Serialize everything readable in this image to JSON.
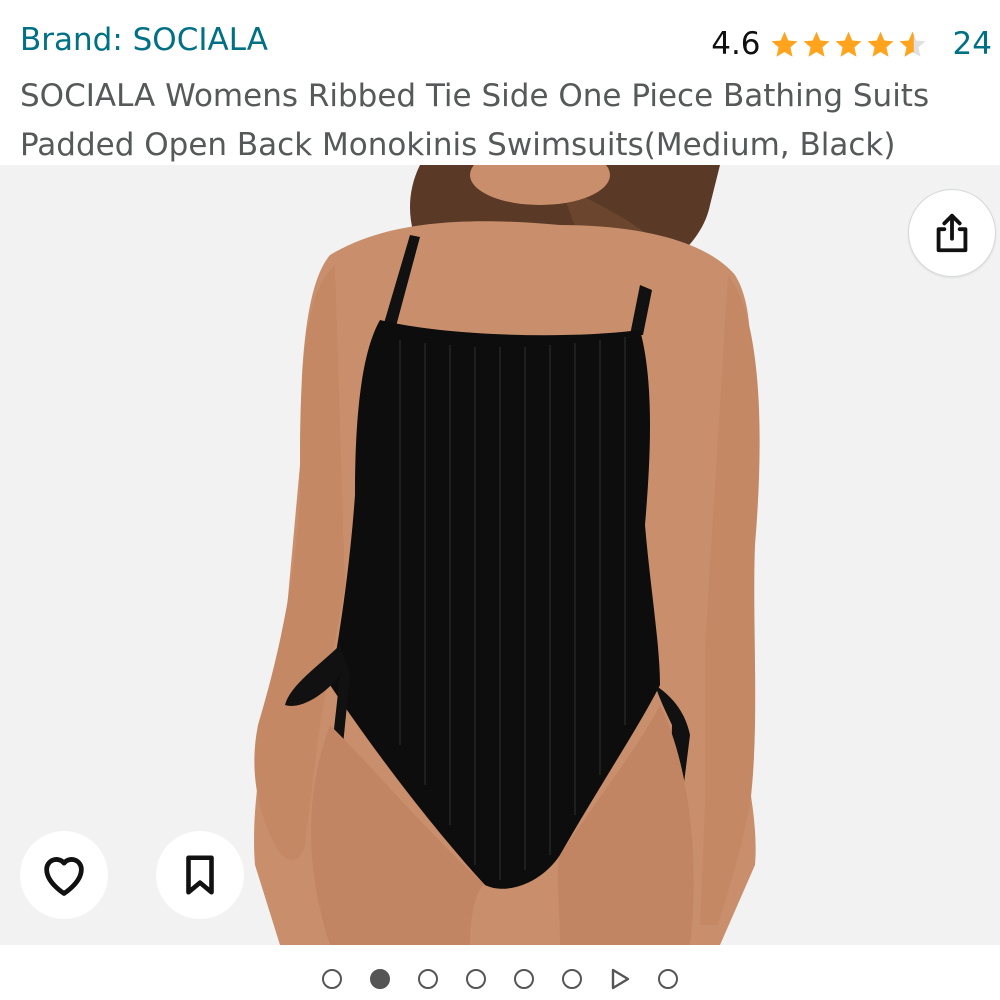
{
  "header": {
    "brand": "Brand: SOCIALA",
    "rating_value": "4.6",
    "rating_stars": 4.6,
    "rating_count": "24",
    "title": "SOCIALA Womens Ribbed Tie Side One Piece Bathing Suits Padded Open Back Monokinis Swimsuits(Medium, Black)"
  },
  "gallery": {
    "image": "black-ribbed-one-piece-swimsuit-photo",
    "share_icon": "share-icon",
    "wishlist_icon": "heart-icon",
    "save_icon": "bookmark-icon",
    "dots": [
      "image",
      "image-active",
      "image",
      "image",
      "image",
      "image",
      "video",
      "image"
    ],
    "active_index": 1
  },
  "colors": {
    "link": "#007185",
    "star": "#FFA41C",
    "text": "#565959"
  }
}
